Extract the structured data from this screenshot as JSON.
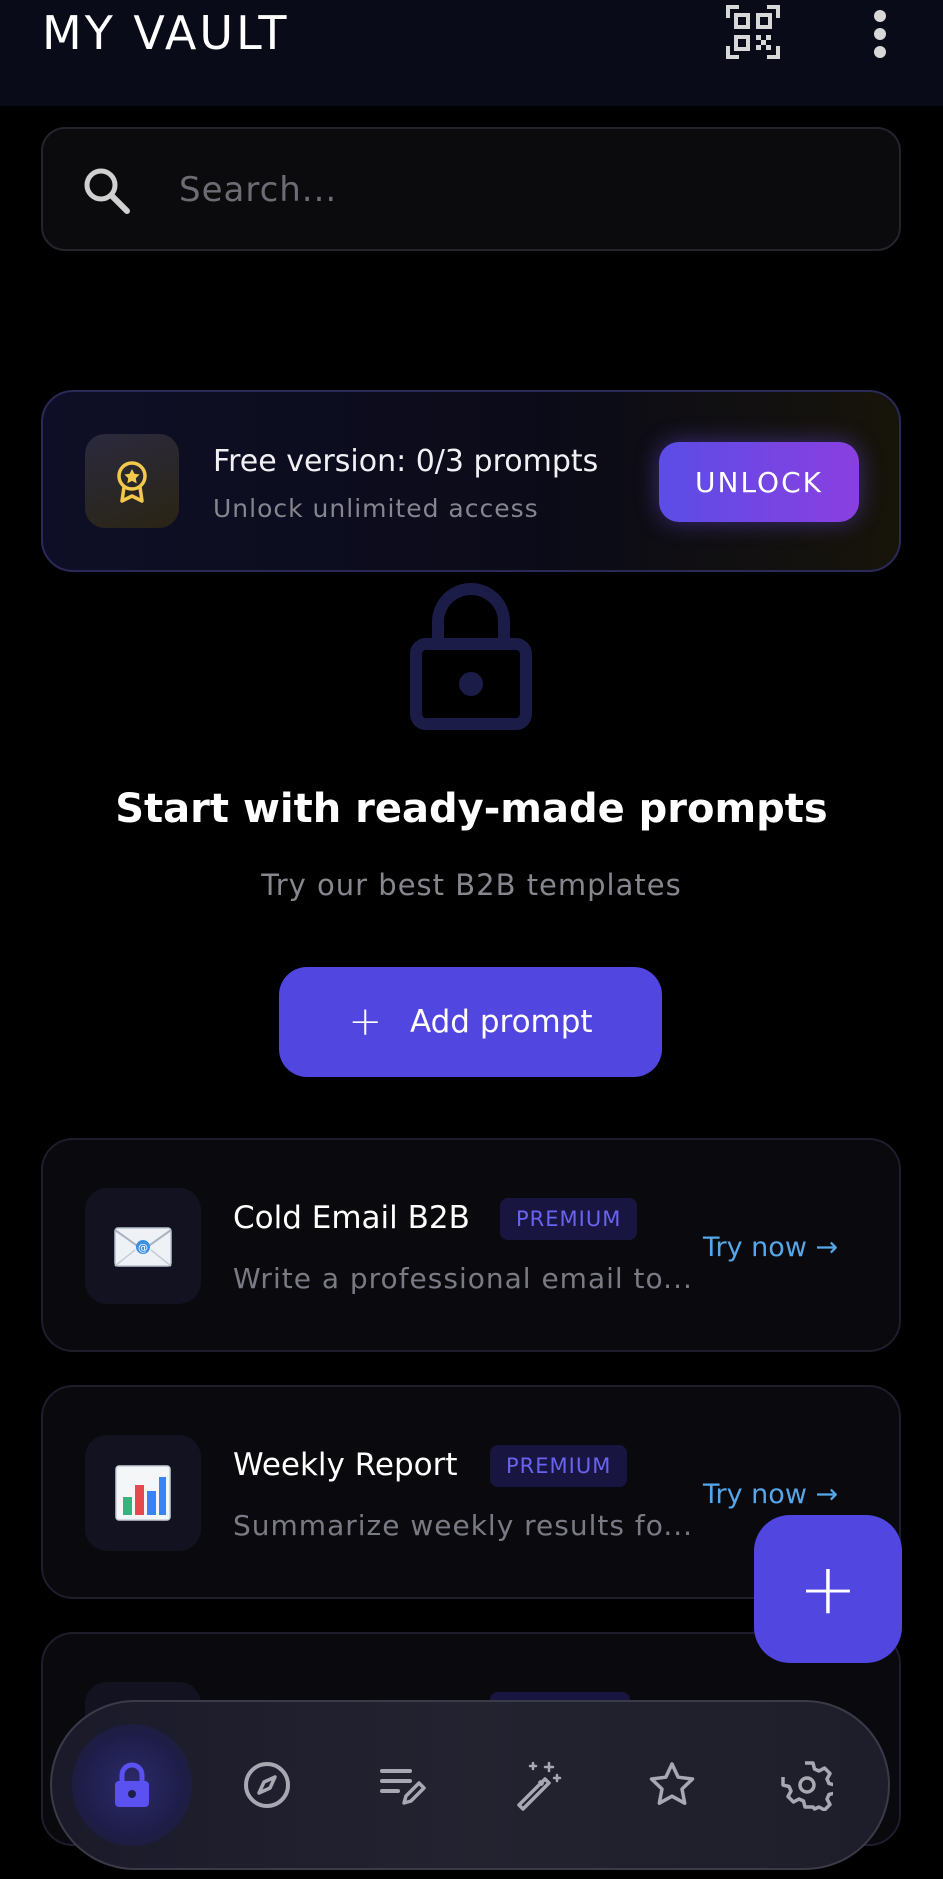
{
  "header": {
    "title": "MY VAULT",
    "qr_icon": "qr-code-icon",
    "more_icon": "more-vertical-icon"
  },
  "search": {
    "placeholder": "Search...",
    "icon": "search-icon"
  },
  "banner": {
    "icon": "award-badge-icon",
    "title": "Free version: 0/3 prompts",
    "subtitle": "Unlock unlimited access",
    "button_label": "UNLOCK",
    "accent_color": "#5b4de6"
  },
  "empty_state": {
    "icon": "lock-icon",
    "title": "Start with ready-made prompts",
    "subtitle": "Try our best B2B templates",
    "add_button_label": "Add prompt"
  },
  "templates": [
    {
      "title": "Cold Email B2B",
      "badge": "PREMIUM",
      "description": "Write a professional email to...",
      "action": "Try now →",
      "icon": "email-icon"
    },
    {
      "title": "Weekly Report",
      "badge": "PREMIUM",
      "description": "Summarize weekly results fo...",
      "action": "Try now →",
      "icon": "bar-chart-icon"
    }
  ],
  "fab": {
    "label": "+"
  },
  "bottom_nav": {
    "items": [
      {
        "name": "vault",
        "icon": "lock-icon",
        "active": true
      },
      {
        "name": "explore",
        "icon": "compass-icon",
        "active": false
      },
      {
        "name": "edit",
        "icon": "edit-list-icon",
        "active": false
      },
      {
        "name": "magic",
        "icon": "magic-wand-icon",
        "active": false
      },
      {
        "name": "favorites",
        "icon": "star-icon",
        "active": false
      },
      {
        "name": "settings",
        "icon": "gear-icon",
        "active": false
      }
    ]
  },
  "colors": {
    "primary": "#5146e0",
    "link": "#56a6e8",
    "badge_text": "#6a62f0",
    "gold": "#f2c94c"
  }
}
